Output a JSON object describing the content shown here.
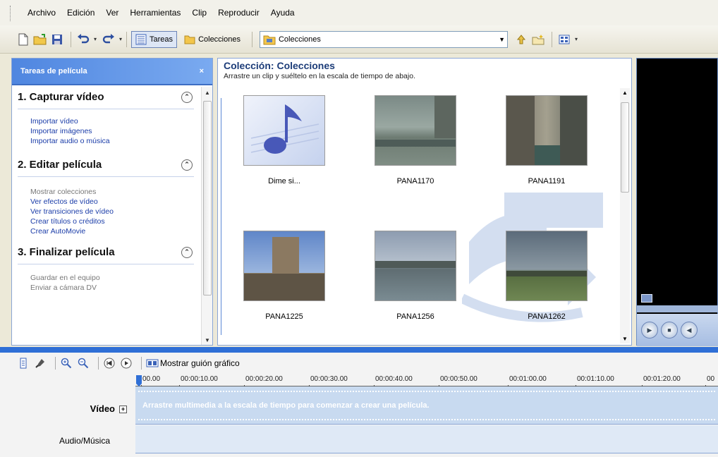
{
  "menu": {
    "items": [
      "Archivo",
      "Edición",
      "Ver",
      "Herramientas",
      "Clip",
      "Reproducir",
      "Ayuda"
    ]
  },
  "toolbar": {
    "tasks_label": "Tareas",
    "collections_label": "Colecciones",
    "combo_value": "Colecciones"
  },
  "taskpane": {
    "title": "Tareas de película",
    "close": "×",
    "sections": [
      {
        "title": "1. Capturar vídeo",
        "links": [
          "Importar vídeo",
          "Importar imágenes",
          "Importar audio o música"
        ]
      },
      {
        "title": "2. Editar película",
        "links": [
          "Mostrar colecciones",
          "Ver efectos de vídeo",
          "Ver transiciones de vídeo",
          "Crear títulos o créditos",
          "Crear AutoMovie"
        ]
      },
      {
        "title": "3. Finalizar película",
        "links": [
          "Guardar en el equipo",
          "Enviar a cámara DV"
        ]
      }
    ]
  },
  "collection": {
    "title": "Colección: Colecciones",
    "subtitle": "Arrastre un clip y suéltelo en la escala de tiempo de abajo.",
    "clips": [
      {
        "label": "Dime si...",
        "kind": "audio"
      },
      {
        "label": "PANA1170",
        "kind": "video"
      },
      {
        "label": "PANA1191",
        "kind": "video"
      },
      {
        "label": "PANA1225",
        "kind": "video"
      },
      {
        "label": "PANA1256",
        "kind": "video"
      },
      {
        "label": "PANA1262",
        "kind": "video"
      }
    ]
  },
  "timeline": {
    "storyboard_label": "Mostrar guión gráfico",
    "ruler": [
      "00.00",
      "00:00:10.00",
      "00:00:20.00",
      "00:00:30.00",
      "00:00:40.00",
      "00:00:50.00",
      "00:01:00.00",
      "00:01:10.00",
      "00:01:20.00",
      "00"
    ],
    "video_label": "Vídeo",
    "video_plus": "+",
    "audio_label": "Audio/Música",
    "hint": "Arrastre multimedia a la escala de tiempo para comenzar a crear una película."
  },
  "colors": {
    "accent": "#2f6fd6",
    "link": "#1a3ca8",
    "header_blue": "#4f86e0"
  }
}
